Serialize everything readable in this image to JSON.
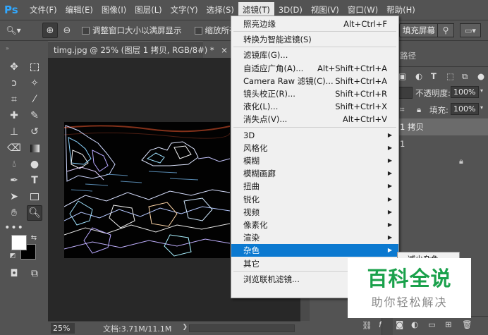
{
  "app": {
    "logo": "Ps"
  },
  "menubar": {
    "items": [
      "文件(F)",
      "编辑(E)",
      "图像(I)",
      "图层(L)",
      "文字(Y)",
      "选择(S)",
      "滤镜(T)",
      "3D(D)",
      "视图(V)",
      "窗口(W)",
      "帮助(H)"
    ],
    "active_index": 6
  },
  "options": {
    "resize_windows_label": "调整窗口大小以满屏显示",
    "zoom_all_label": "缩放所有",
    "fill_screen_label": "填充屏幕"
  },
  "document": {
    "tab_title": "timg.jpg @ 25% (图层 1 拷贝, RGB/8#) *",
    "close_glyph": "×",
    "zoom": "25%",
    "size_info": "文档:3.71M/11.1M"
  },
  "filter_menu": {
    "groups": [
      [
        {
          "label": "照亮边缘",
          "shortcut": "Alt+Ctrl+F"
        }
      ],
      [
        {
          "label": "转换为智能滤镜(S)",
          "shortcut": ""
        }
      ],
      [
        {
          "label": "滤镜库(G)...",
          "shortcut": ""
        },
        {
          "label": "自适应广角(A)...",
          "shortcut": "Alt+Shift+Ctrl+A"
        },
        {
          "label": "Camera Raw 滤镜(C)...",
          "shortcut": "Shift+Ctrl+A"
        },
        {
          "label": "镜头校正(R)...",
          "shortcut": "Shift+Ctrl+R"
        },
        {
          "label": "液化(L)...",
          "shortcut": "Shift+Ctrl+X"
        },
        {
          "label": "消失点(V)...",
          "shortcut": "Alt+Ctrl+V"
        }
      ],
      [
        {
          "label": "3D",
          "submenu": true
        },
        {
          "label": "风格化",
          "submenu": true
        },
        {
          "label": "模糊",
          "submenu": true
        },
        {
          "label": "模糊画廊",
          "submenu": true
        },
        {
          "label": "扭曲",
          "submenu": true
        },
        {
          "label": "锐化",
          "submenu": true
        },
        {
          "label": "视频",
          "submenu": true
        },
        {
          "label": "像素化",
          "submenu": true
        },
        {
          "label": "渲染",
          "submenu": true
        },
        {
          "label": "杂色",
          "submenu": true,
          "highlighted": true
        },
        {
          "label": "其它",
          "submenu": true
        }
      ],
      [
        {
          "label": "浏览联机滤镜...",
          "shortcut": ""
        }
      ]
    ],
    "submenu_partial_label": "减少杂色..."
  },
  "layers_panel": {
    "tab_fragment": "路径",
    "opacity_label": "不透明度:",
    "opacity_value": "100%",
    "fill_label": "填充:",
    "fill_value": "100%",
    "layer_kind_value": "",
    "layers": [
      {
        "name_fragment": "1 拷贝",
        "selected": true
      },
      {
        "name_fragment": "1",
        "selected": false
      }
    ],
    "bottom_fx_label": "fx"
  },
  "watermark": {
    "title": "百科全说",
    "subtitle": "助你轻松解决"
  },
  "colors": {
    "accent": "#0b79d0",
    "ps_blue": "#31a8ff",
    "watermark_green": "#1aa14b"
  }
}
